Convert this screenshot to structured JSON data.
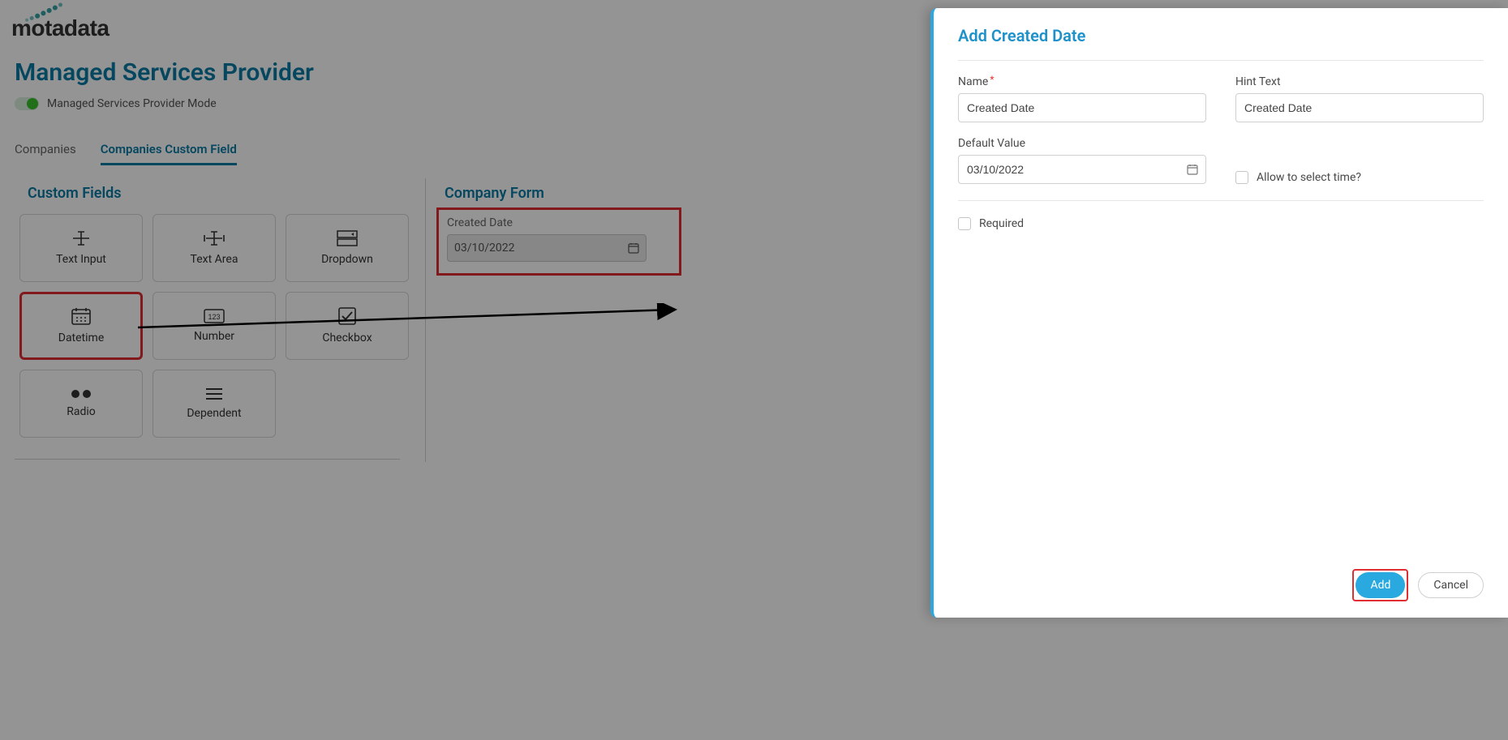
{
  "brand": {
    "name": "motadata"
  },
  "page": {
    "title": "Managed Services Provider",
    "toggle_label": "Managed Services Provider Mode"
  },
  "tabs": {
    "companies": "Companies",
    "custom_field": "Companies Custom Field"
  },
  "sections": {
    "custom_fields": "Custom Fields",
    "company_form": "Company Form"
  },
  "field_types": {
    "text_input": "Text Input",
    "text_area": "Text Area",
    "dropdown": "Dropdown",
    "datetime": "Datetime",
    "number": "Number",
    "checkbox": "Checkbox",
    "radio": "Radio",
    "dependent": "Dependent"
  },
  "company_form": {
    "field_label": "Created Date",
    "field_value": "03/10/2022"
  },
  "panel": {
    "title": "Add Created Date",
    "name_label": "Name",
    "name_value": "Created Date",
    "hint_label": "Hint Text",
    "hint_value": "Created Date",
    "default_label": "Default Value",
    "default_value": "03/10/2022",
    "allow_time_label": "Allow to select time?",
    "required_label": "Required",
    "add_btn": "Add",
    "cancel_btn": "Cancel"
  }
}
